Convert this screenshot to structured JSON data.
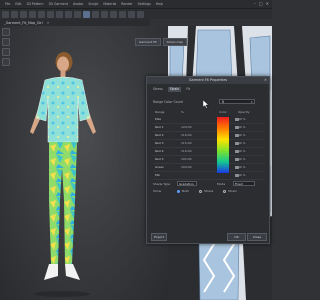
{
  "menubar": {
    "items": [
      "File",
      "Edit",
      "2D Pattern",
      "3D Garment",
      "Avatar",
      "Sculpt",
      "Material",
      "Render",
      "Settings",
      "Help"
    ],
    "window_controls": [
      "–",
      "□",
      "✕"
    ]
  },
  "file_tab": {
    "label": "_Garment_Fit_Map_Girl",
    "close": "✕"
  },
  "pattern_tabs": [
    "Garment Fit",
    "Strain map"
  ],
  "dialog": {
    "title": "Garment Fit Properties",
    "close": "✕",
    "tabs": [
      {
        "label": "Stress",
        "active": false
      },
      {
        "label": "Strain",
        "active": true
      },
      {
        "label": "Fit",
        "active": false
      }
    ],
    "range_color_count": {
      "label": "Range Color Count",
      "value": "8"
    },
    "table": {
      "headers": {
        "name": "Range",
        "percent": "%",
        "color": "Color",
        "opacity": "Opacity"
      },
      "rows": [
        {
          "name": "Max",
          "percent": "",
          "opacity": "90 %"
        },
        {
          "name": "Red 1",
          "percent": "120.00",
          "opacity": "90 %"
        },
        {
          "name": "Red 2",
          "percent": "110.00",
          "opacity": "90 %"
        },
        {
          "name": "Red 3",
          "percent": "115.00",
          "opacity": "90 %"
        },
        {
          "name": "Red 4",
          "percent": "110.00",
          "opacity": "90 %"
        },
        {
          "name": "Red 5",
          "percent": "105.00",
          "opacity": "90 %"
        },
        {
          "name": "Green",
          "percent": "100.00",
          "opacity": "90 %"
        },
        {
          "name": "Min",
          "percent": "",
          "opacity": "90 %"
        }
      ]
    },
    "shade_type": {
      "label": "Shade Type",
      "value": "Gradation",
      "label2": "Mode",
      "value2": "Fixed"
    },
    "show": {
      "label": "Show",
      "options": [
        {
          "label": "Both",
          "selected": true
        },
        {
          "label": "Stress",
          "selected": false
        },
        {
          "label": "Strain",
          "selected": false
        }
      ]
    },
    "buttons": {
      "export": "Export",
      "ok": "OK",
      "close": "Close"
    }
  },
  "colors": {
    "gradient": [
      "#f01e1e",
      "#ff7a00",
      "#ffe200",
      "#7fe22a",
      "#14c890",
      "#1a38e6"
    ],
    "ui_accent": "#5aa0ff"
  }
}
